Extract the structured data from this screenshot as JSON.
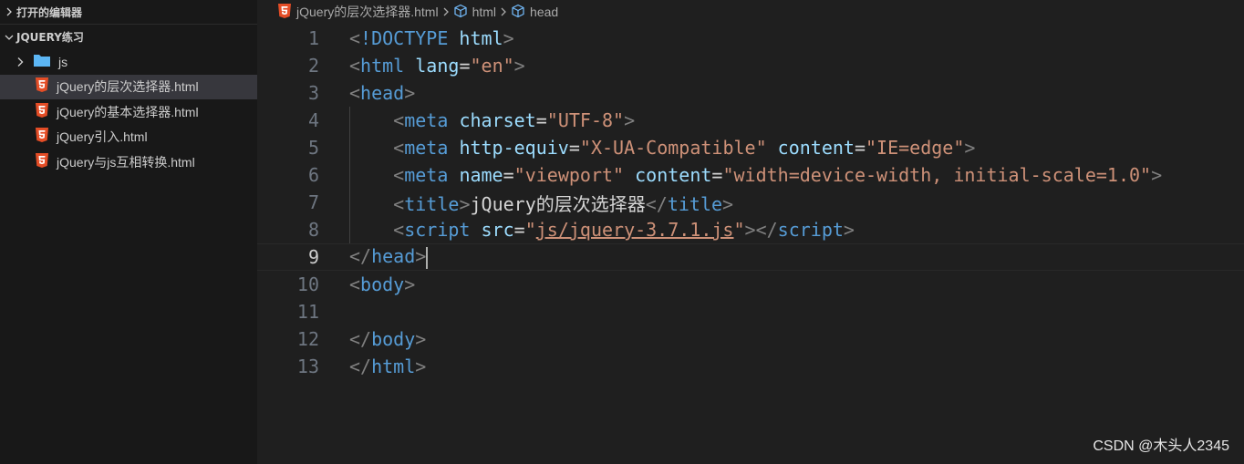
{
  "sidebar": {
    "open_editors_label": "打开的编辑器",
    "project_label": "JQUERY练习",
    "folder": {
      "name": "js",
      "icon": "folder-icon"
    },
    "files": [
      {
        "name": "jQuery的层次选择器.html",
        "icon": "html5-icon",
        "selected": true
      },
      {
        "name": "jQuery的基本选择器.html",
        "icon": "html5-icon",
        "selected": false
      },
      {
        "name": "jQuery引入.html",
        "icon": "html5-icon",
        "selected": false
      },
      {
        "name": "jQuery与js互相转换.html",
        "icon": "html5-icon",
        "selected": false
      }
    ]
  },
  "breadcrumb": {
    "file": "jQuery的层次选择器.html",
    "seg1": "html",
    "seg2": "head"
  },
  "editor": {
    "active_line": 9,
    "line_numbers": [
      "1",
      "2",
      "3",
      "4",
      "5",
      "6",
      "7",
      "8",
      "9",
      "10",
      "11",
      "12",
      "13"
    ],
    "tokens": {
      "doctype_kw": "!DOCTYPE",
      "doctype_val": "html",
      "html": "html",
      "lang": "lang",
      "en": "\"en\"",
      "head": "head",
      "meta": "meta",
      "charset": "charset",
      "utf8": "\"UTF-8\"",
      "http_equiv": "http-equiv",
      "xua": "\"X-UA-Compatible\"",
      "content": "content",
      "ie_edge": "\"IE=edge\"",
      "name": "name",
      "viewport": "\"viewport\"",
      "viewport_content": "\"width=device-width, initial-scale=1.0\"",
      "title": "title",
      "title_text": "jQuery的层次选择器",
      "script": "script",
      "src": "src",
      "src_val": "js/jquery-3.7.1.js",
      "body": "body"
    }
  },
  "watermark": "CSDN @木头人2345",
  "colors": {
    "tag": "#569cd6",
    "attr": "#9cdcfe",
    "string": "#ce9178",
    "punct": "#808080",
    "html5_icon": "#e44d26",
    "folder_icon": "#5cb6f4"
  }
}
